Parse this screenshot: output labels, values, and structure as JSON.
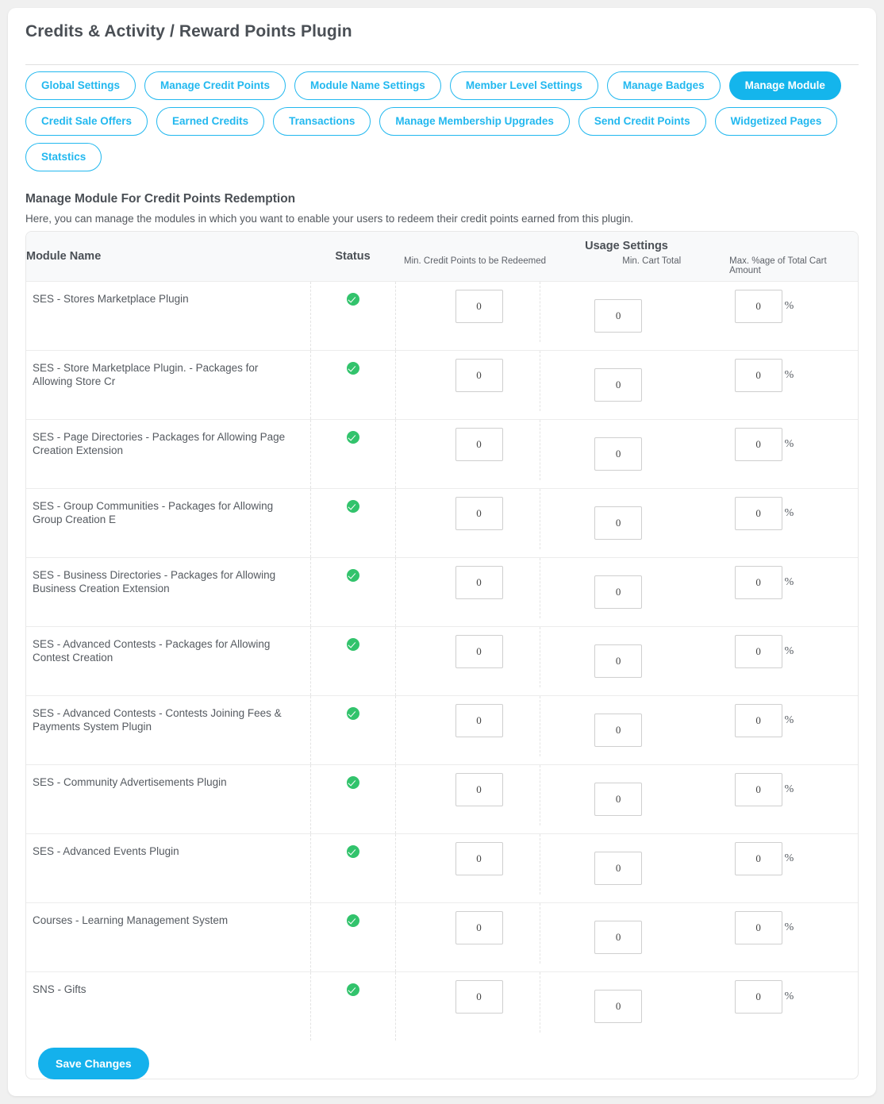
{
  "header": {
    "title": "Credits & Activity / Reward Points Plugin"
  },
  "tabs": [
    {
      "label": "Global Settings",
      "active": false
    },
    {
      "label": "Manage Credit Points",
      "active": false
    },
    {
      "label": "Module Name Settings",
      "active": false
    },
    {
      "label": "Member Level Settings",
      "active": false
    },
    {
      "label": "Manage Badges",
      "active": false
    },
    {
      "label": "Manage Module",
      "active": true
    },
    {
      "label": "Credit Sale Offers",
      "active": false
    },
    {
      "label": "Earned Credits",
      "active": false
    },
    {
      "label": "Transactions",
      "active": false
    },
    {
      "label": "Manage Membership Upgrades",
      "active": false
    },
    {
      "label": "Send Credit Points",
      "active": false
    },
    {
      "label": "Widgetized Pages",
      "active": false
    },
    {
      "label": "Statstics",
      "active": false
    }
  ],
  "section": {
    "title": "Manage Module For Credit Points Redemption",
    "description": "Here, you can manage the modules in which you want to enable your users to redeem their credit points earned from this plugin."
  },
  "table": {
    "headers": {
      "module_name": "Module Name",
      "status": "Status",
      "usage_settings": "Usage Settings",
      "min_credit_points": "Min. Credit Points to be Redeemed",
      "min_cart_total": "Min. Cart Total",
      "max_pct_cart": "Max. %age of Total Cart Amount"
    },
    "percent_symbol": "%",
    "status_icon": "check-circle-icon",
    "rows": [
      {
        "module_name": "SES - Stores Marketplace Plugin",
        "status": "enabled",
        "min_credit_points": "0",
        "min_cart_total": "0",
        "max_pct_cart": "0"
      },
      {
        "module_name": "SES - Store Marketplace Plugin. - Packages for Allowing Store Cr",
        "status": "enabled",
        "min_credit_points": "0",
        "min_cart_total": "0",
        "max_pct_cart": "0"
      },
      {
        "module_name": "SES - Page Directories - Packages for Allowing Page Creation Extension",
        "status": "enabled",
        "min_credit_points": "0",
        "min_cart_total": "0",
        "max_pct_cart": "0"
      },
      {
        "module_name": "SES - Group Communities - Packages for Allowing Group Creation E",
        "status": "enabled",
        "min_credit_points": "0",
        "min_cart_total": "0",
        "max_pct_cart": "0"
      },
      {
        "module_name": "SES - Business Directories - Packages for Allowing Business Creation Extension",
        "status": "enabled",
        "min_credit_points": "0",
        "min_cart_total": "0",
        "max_pct_cart": "0"
      },
      {
        "module_name": "SES - Advanced Contests - Packages for Allowing Contest Creation",
        "status": "enabled",
        "min_credit_points": "0",
        "min_cart_total": "0",
        "max_pct_cart": "0"
      },
      {
        "module_name": "SES - Advanced Contests - Contests Joining Fees & Payments System Plugin",
        "status": "enabled",
        "min_credit_points": "0",
        "min_cart_total": "0",
        "max_pct_cart": "0"
      },
      {
        "module_name": "SES - Community Advertisements Plugin",
        "status": "enabled",
        "min_credit_points": "0",
        "min_cart_total": "0",
        "max_pct_cart": "0"
      },
      {
        "module_name": "SES - Advanced Events Plugin",
        "status": "enabled",
        "min_credit_points": "0",
        "min_cart_total": "0",
        "max_pct_cart": "0"
      },
      {
        "module_name": "Courses - Learning Management System",
        "status": "enabled",
        "min_credit_points": "0",
        "min_cart_total": "0",
        "max_pct_cart": "0"
      },
      {
        "module_name": "SNS - Gifts",
        "status": "enabled",
        "min_credit_points": "0",
        "min_cart_total": "0",
        "max_pct_cart": "0"
      }
    ]
  },
  "footer": {
    "save_label": "Save Changes"
  },
  "colors": {
    "accent": "#14b5ec",
    "accent_border": "#22b8ef",
    "status_green": "#32c36c",
    "text_dark": "#4a4f55",
    "page_bg": "#f0f0f0"
  }
}
